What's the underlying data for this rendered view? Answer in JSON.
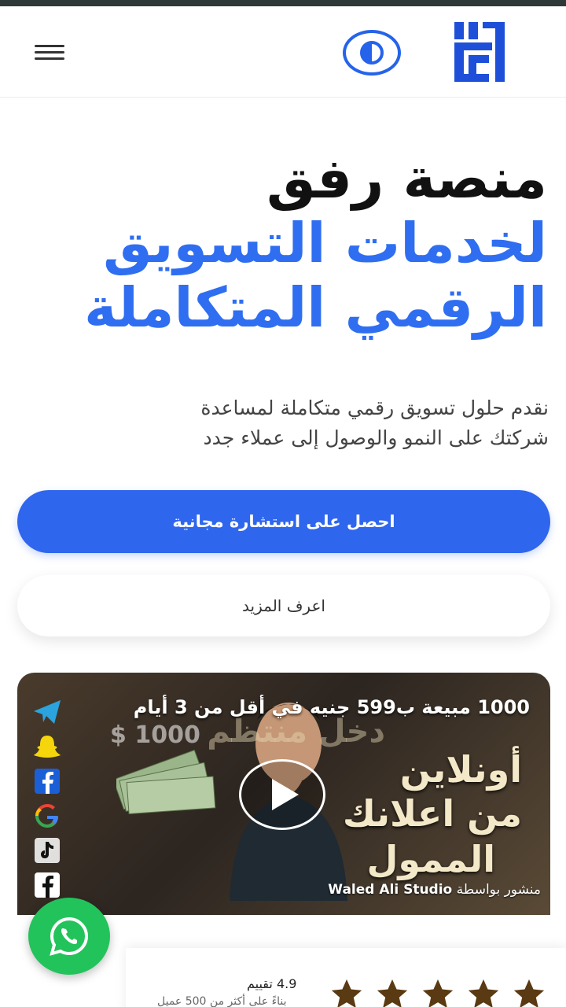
{
  "header": {
    "logo_text": "رفق",
    "menu_label": "menu-icon",
    "theme_toggle": "contrast-icon"
  },
  "hero": {
    "line1": "منصة رفق",
    "line2": "لخدمات التسويق",
    "line3": "الرقمي المتكاملة",
    "accent_color": "#2f6ef1"
  },
  "description": {
    "line1": "نقدم حلول تسويق رقمي متكاملة لمساعدة",
    "line2": "شركتك على النمو والوصول إلى عملاء جدد"
  },
  "buttons": {
    "primary_label": "احصل على استشارة مجانية",
    "secondary_label": "اعرف المزيد",
    "primary_color": "#2f66ee"
  },
  "video": {
    "title": "1000 مبيعة ب599 جنيه في أقل من 3 أيام",
    "big_line1": "أونلاين",
    "big_line2": "من اعلانك",
    "big_line3": "الممول",
    "bg_text": "دخل منتظم",
    "money": "1000 $",
    "posted_prefix": "منشور بواسطة",
    "posted_by": "Waled Ali Studio",
    "social_icons": [
      "telegram-icon",
      "snapchat-icon",
      "facebook-icon",
      "google-icon",
      "tiktok-icon",
      "facebook-icon"
    ]
  },
  "rating": {
    "value": "4.9 تقييم",
    "sub": "بناءً على أكثر من 500 عميل",
    "stars": 5,
    "star_color": "#5a3a12"
  },
  "whatsapp": {
    "color": "#23c35b"
  }
}
